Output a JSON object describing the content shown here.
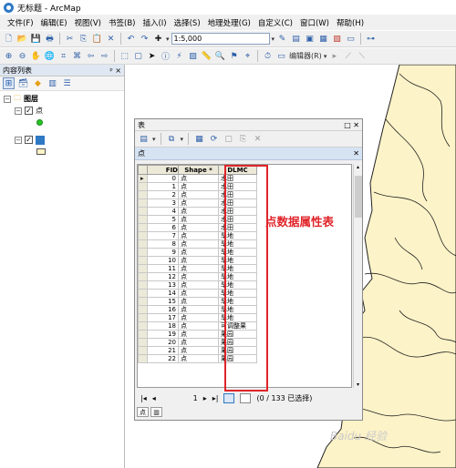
{
  "window": {
    "title": "无标题 - ArcMap"
  },
  "menu": [
    "文件(F)",
    "编辑(E)",
    "视图(V)",
    "书签(B)",
    "插入(I)",
    "选择(S)",
    "地理处理(G)",
    "自定义(C)",
    "窗口(W)",
    "帮助(H)"
  ],
  "toolbar": {
    "scale": "1:5,000",
    "editor_label": "编辑器(R)"
  },
  "toc": {
    "title": "内容列表",
    "pin": "ᵖ ×",
    "layers_label": "图层",
    "layer_point": "点"
  },
  "table_window": {
    "title": "表",
    "tab_name": "点",
    "columns": [
      "FID",
      "Shape *",
      "DLMC"
    ],
    "rows": [
      [
        "0",
        "点",
        "水田"
      ],
      [
        "1",
        "点",
        "水田"
      ],
      [
        "2",
        "点",
        "水田"
      ],
      [
        "3",
        "点",
        "水田"
      ],
      [
        "4",
        "点",
        "水田"
      ],
      [
        "5",
        "点",
        "水田"
      ],
      [
        "6",
        "点",
        "水田"
      ],
      [
        "7",
        "点",
        "旱地"
      ],
      [
        "8",
        "点",
        "旱地"
      ],
      [
        "9",
        "点",
        "旱地"
      ],
      [
        "10",
        "点",
        "旱地"
      ],
      [
        "11",
        "点",
        "旱地"
      ],
      [
        "12",
        "点",
        "旱地"
      ],
      [
        "13",
        "点",
        "旱地"
      ],
      [
        "14",
        "点",
        "旱地"
      ],
      [
        "15",
        "点",
        "旱地"
      ],
      [
        "16",
        "点",
        "旱地"
      ],
      [
        "17",
        "点",
        "旱地"
      ],
      [
        "18",
        "点",
        "可调整果"
      ],
      [
        "19",
        "点",
        "果园"
      ],
      [
        "20",
        "点",
        "果园"
      ],
      [
        "21",
        "点",
        "果园"
      ],
      [
        "22",
        "点",
        "果园"
      ]
    ],
    "current_record": "1",
    "status": "(0 / 133 已选择)"
  },
  "annotation": "点数据属性表",
  "watermark": "Baidu 经验",
  "colors": {
    "highlight": "#e0242a",
    "map_fill": "#fdf3c8",
    "point": "#27c427"
  }
}
